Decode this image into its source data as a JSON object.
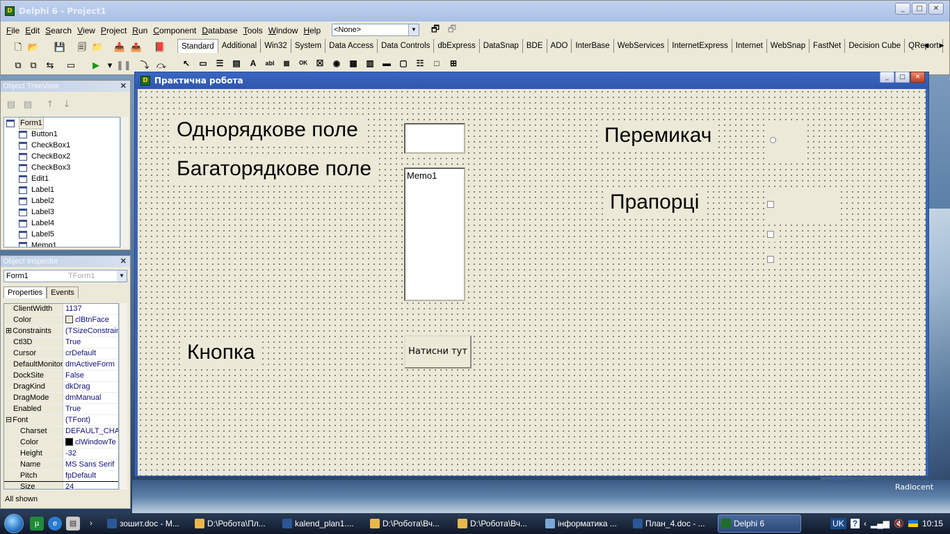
{
  "main_window": {
    "title": "Delphi 6 - Project1",
    "menu": [
      "File",
      "Edit",
      "Search",
      "View",
      "Project",
      "Run",
      "Component",
      "Database",
      "Tools",
      "Window",
      "Help"
    ],
    "combo_value": "<None>",
    "palette_tabs": [
      "Standard",
      "Additional",
      "Win32",
      "System",
      "Data Access",
      "Data Controls",
      "dbExpress",
      "DataSnap",
      "BDE",
      "ADO",
      "InterBase",
      "WebServices",
      "InternetExpress",
      "Internet",
      "WebSnap",
      "FastNet",
      "Decision Cube",
      "QReport"
    ],
    "active_palette_tab": "Standard"
  },
  "object_treeview": {
    "title": "Object TreeView",
    "items": [
      "Form1",
      "Button1",
      "CheckBox1",
      "CheckBox2",
      "CheckBox3",
      "Edit1",
      "Label1",
      "Label2",
      "Label3",
      "Label4",
      "Label5",
      "Memo1"
    ]
  },
  "object_inspector": {
    "title": "Object Inspector",
    "selected_object": "Form1",
    "selected_class": "TForm1",
    "tabs": [
      "Properties",
      "Events"
    ],
    "properties": [
      {
        "name": "ClientWidth",
        "value": "1137",
        "kind": "plain"
      },
      {
        "name": "Color",
        "value": "clBtnFace",
        "kind": "color",
        "swatch": "#ece9d8"
      },
      {
        "name": "Constraints",
        "value": "(TSizeConstrain",
        "kind": "group"
      },
      {
        "name": "Ctl3D",
        "value": "True",
        "kind": "plain"
      },
      {
        "name": "Cursor",
        "value": "crDefault",
        "kind": "plain"
      },
      {
        "name": "DefaultMonitor",
        "value": "dmActiveForm",
        "kind": "plain"
      },
      {
        "name": "DockSite",
        "value": "False",
        "kind": "plain"
      },
      {
        "name": "DragKind",
        "value": "dkDrag",
        "kind": "plain"
      },
      {
        "name": "DragMode",
        "value": "dmManual",
        "kind": "plain"
      },
      {
        "name": "Enabled",
        "value": "True",
        "kind": "plain"
      },
      {
        "name": "Font",
        "value": "(TFont)",
        "kind": "groupopen"
      },
      {
        "name": "Charset",
        "value": "DEFAULT_CHA",
        "kind": "sub"
      },
      {
        "name": "Color",
        "value": "clWindowTe",
        "kind": "subcolor",
        "swatch": "#000000"
      },
      {
        "name": "Height",
        "value": "-32",
        "kind": "sub"
      },
      {
        "name": "Name",
        "value": "MS Sans Serif",
        "kind": "sub"
      },
      {
        "name": "Pitch",
        "value": "fpDefault",
        "kind": "sub"
      },
      {
        "name": "Size",
        "value": "24",
        "kind": "sub"
      }
    ],
    "status": "All shown"
  },
  "form": {
    "title": "Практична робота",
    "label_single_line": "Однорядкове поле",
    "label_multi_line": "Багаторядкове поле",
    "label_switch": "Перемикач",
    "label_flags": "Прапорці",
    "label_button": "Кнопка",
    "memo_text": "Memo1",
    "button_text": "Натисни тут"
  },
  "desktop": {
    "watermark": "Radiocent"
  },
  "taskbar": {
    "tasks": [
      {
        "label": "зошит.doc - M...",
        "color": "#2b5797"
      },
      {
        "label": "D:\\Робота\\Пл...",
        "color": "#e8b84a"
      },
      {
        "label": "kalend_plan1....",
        "color": "#2b5797"
      },
      {
        "label": "D:\\Робота\\Вч...",
        "color": "#e8b84a"
      },
      {
        "label": "D:\\Робота\\Вч...",
        "color": "#e8b84a"
      },
      {
        "label": "інформатика ...",
        "color": "#7aa7d8"
      },
      {
        "label": "План_4.doc - ...",
        "color": "#2b5797"
      },
      {
        "label": "Delphi 6",
        "color": "#1f6d2a",
        "active": true
      }
    ],
    "language": "UK",
    "time": "10:15"
  }
}
